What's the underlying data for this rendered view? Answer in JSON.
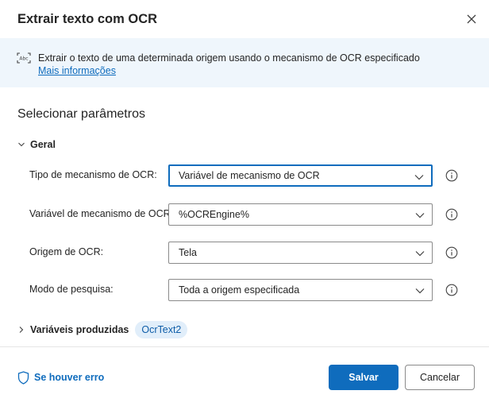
{
  "dialog": {
    "title": "Extrair texto com OCR",
    "close_icon": "close-icon"
  },
  "info": {
    "icon": "text-recognition-icon",
    "description": "Extrair o texto de uma determinada origem usando o mecanismo de OCR especificado",
    "link": "Mais informações"
  },
  "section": {
    "title": "Selecionar parâmetros"
  },
  "general": {
    "label": "Geral",
    "expanded": true,
    "fields": [
      {
        "label": "Tipo de mecanismo de OCR:",
        "value": "Variável de mecanismo de OCR"
      },
      {
        "label": "Variável de mecanismo de OCR:",
        "value": "%OCREngine%"
      },
      {
        "label": "Origem de OCR:",
        "value": "Tela"
      },
      {
        "label": "Modo de pesquisa:",
        "value": "Toda a origem especificada"
      }
    ]
  },
  "produced": {
    "label": "Variáveis produzidas",
    "expanded": false,
    "variables": [
      "OcrText2"
    ]
  },
  "footer": {
    "error_label": "Se houver erro",
    "save_label": "Salvar",
    "cancel_label": "Cancelar"
  },
  "colors": {
    "accent": "#0f6cbd",
    "info_background": "#eff6fc",
    "chip_background": "#e1eefa"
  }
}
